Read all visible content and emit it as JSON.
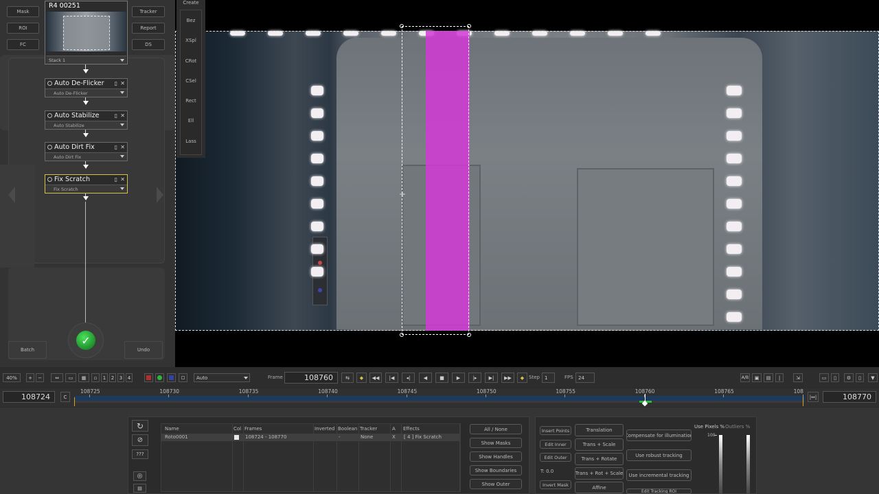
{
  "left_panel": {
    "buttons": {
      "mask": "Mask",
      "roi": "ROI",
      "fc": "FC",
      "tracker": "Tracker",
      "report": "Report",
      "ds": "DS",
      "batch": "Batch",
      "undo": "Undo"
    },
    "clip_title": "R4 00251",
    "stack_label": "Stack 1",
    "nodes": [
      {
        "title": "Auto De-Flicker",
        "sub": "Auto De-Flicker"
      },
      {
        "title": "Auto Stabilize",
        "sub": "Auto Stabilize"
      },
      {
        "title": "Auto Dirt Fix",
        "sub": "Auto Dirt Fix"
      },
      {
        "title": "Fix Scratch",
        "sub": "Fix Scratch"
      }
    ]
  },
  "create_bar": {
    "title": "Create",
    "items": [
      "Bez",
      "XSpl",
      "CRot",
      "CSel",
      "Rect",
      "Ell",
      "Lass"
    ]
  },
  "toolbar": {
    "zoom": "40%",
    "views": [
      "1",
      "2",
      "3",
      "4"
    ],
    "mode": "Auto",
    "frame_label": "Frame",
    "frame": "108760",
    "step_label": "Step",
    "step": "1",
    "fps_label": "FPS",
    "fps": "24",
    "ab": "A/B"
  },
  "timeline": {
    "start": "108724",
    "end": "108770",
    "c": "C",
    "ticks": [
      "108725",
      "108730",
      "108735",
      "108740",
      "108745",
      "108750",
      "108755",
      "108760",
      "108765",
      "108"
    ]
  },
  "mask_table": {
    "headers": [
      "Name",
      "Col",
      "Frames",
      "Inverted",
      "Boolean",
      "Tracker",
      "A",
      "Effects"
    ],
    "row": [
      "Roto0001",
      "",
      "108724 - 108770",
      "",
      "-",
      "None",
      "X",
      "[ 4 ] Fix Scratch"
    ],
    "side_button": "???"
  },
  "mask_buttons": [
    "All / None",
    "Show Masks",
    "Show Handles",
    "Show Boundaries",
    "Show Outer"
  ],
  "tracking": {
    "left": [
      "Insert Points",
      "Edit Inner",
      "Edit Outer",
      "T: 0.0",
      "Invert Mask"
    ],
    "mid": [
      "Translation",
      "Trans + Scale",
      "Trans + Rotate",
      "Trans + Rot + Scale",
      "Affine"
    ],
    "right": [
      "Compensate for illumination",
      "Use robust tracking",
      "Use incremental tracking",
      "Edit Tracking ROI"
    ],
    "use_pixels": "Use Pixels %",
    "outliers": "Outliers %",
    "scale_100": "100"
  },
  "colors": {
    "magenta": "#d23ad6",
    "accent_green": "#2db83d",
    "selection_yellow": "#d8c14a"
  }
}
